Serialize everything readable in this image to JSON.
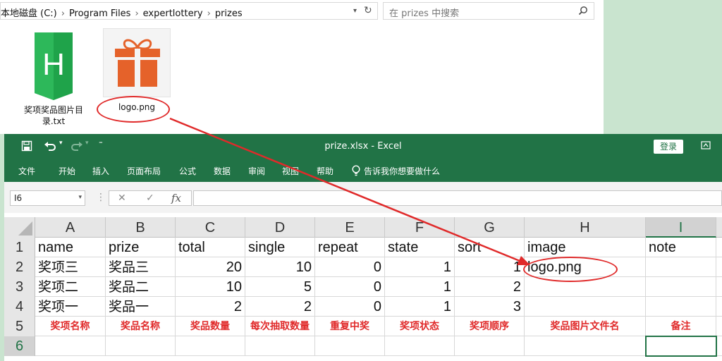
{
  "explorer": {
    "path_root": "本地磁盘 (C:)",
    "path_1": "Program Files",
    "path_2": "expertlottery",
    "path_3": "prizes",
    "search_placeholder": "在 prizes 中搜索",
    "files": [
      {
        "name_line1": "奖项奖品图片目",
        "name_line2": "录.txt",
        "icon": "text-file-icon",
        "icon_letter": "H"
      },
      {
        "name": "logo.png",
        "icon": "gift-image-icon"
      }
    ]
  },
  "excel": {
    "title": "prize.xlsx  -  Excel",
    "login": "登录",
    "ribbon_tabs": [
      "文件",
      "开始",
      "插入",
      "页面布局",
      "公式",
      "数据",
      "审阅",
      "视图",
      "帮助",
      "告诉我你想要做什么"
    ],
    "name_box": "I6",
    "formula_tools": [
      "✕",
      "✓",
      "fx"
    ],
    "formula_value": "",
    "columns": [
      "A",
      "B",
      "C",
      "D",
      "E",
      "F",
      "G",
      "H",
      "I"
    ],
    "rows": [
      {
        "num": "1",
        "cells": [
          "name",
          "prize",
          "total",
          "single",
          "repeat",
          "state",
          "sort",
          "image",
          "note"
        ]
      },
      {
        "num": "2",
        "cells": [
          "奖项三",
          "奖品三",
          "20",
          "10",
          "0",
          "1",
          "1",
          "logo.png",
          ""
        ]
      },
      {
        "num": "3",
        "cells": [
          "奖项二",
          "奖品二",
          "10",
          "5",
          "0",
          "1",
          "2",
          "",
          ""
        ]
      },
      {
        "num": "4",
        "cells": [
          "奖项一",
          "奖品一",
          "2",
          "2",
          "0",
          "1",
          "3",
          "",
          ""
        ]
      },
      {
        "num": "5",
        "cells": [
          "奖项名称",
          "奖品名称",
          "奖品数量",
          "每次抽取数量",
          "重复中奖",
          "奖项状态",
          "奖项顺序",
          "奖品图片文件名",
          "备注"
        ]
      },
      {
        "num": "6",
        "cells": [
          "",
          "",
          "",
          "",
          "",
          "",
          "",
          "",
          ""
        ]
      }
    ]
  },
  "colors": {
    "excel_green": "#217346",
    "annotation_red": "#e02a2a"
  }
}
